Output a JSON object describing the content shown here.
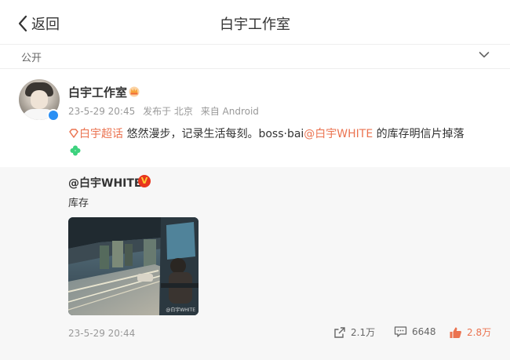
{
  "header": {
    "back_label": "返回",
    "title": "白宇工作室"
  },
  "visibility": {
    "label": "公开"
  },
  "post": {
    "username": "白宇工作室",
    "meta": {
      "time": "23-5-29 20:45",
      "location": "发布于 北京",
      "source": "来自 Android"
    },
    "topic": "白宇超话",
    "text_before_mention": " 悠然漫步，记录生活每刻。boss·bai",
    "mention": "@白宇WHITE",
    "text_after_mention": " 的库存明信片掉落"
  },
  "repost": {
    "username": "@白宇WHITE",
    "badge": "V",
    "text": "库存",
    "photo_watermark": "@白宇WHITE",
    "time": "23-5-29 20:44",
    "actions": {
      "share": "2.1万",
      "comments": "6648",
      "likes": "2.8万"
    }
  },
  "colors": {
    "accent": "#eb7350",
    "verified": "#2a8ff4",
    "clover": "#3dd27e"
  },
  "icons": [
    "chevron-left-icon",
    "chevron-down-icon",
    "crown-icon",
    "topic-icon",
    "clover-icon",
    "share-icon",
    "comment-icon",
    "like-icon"
  ]
}
